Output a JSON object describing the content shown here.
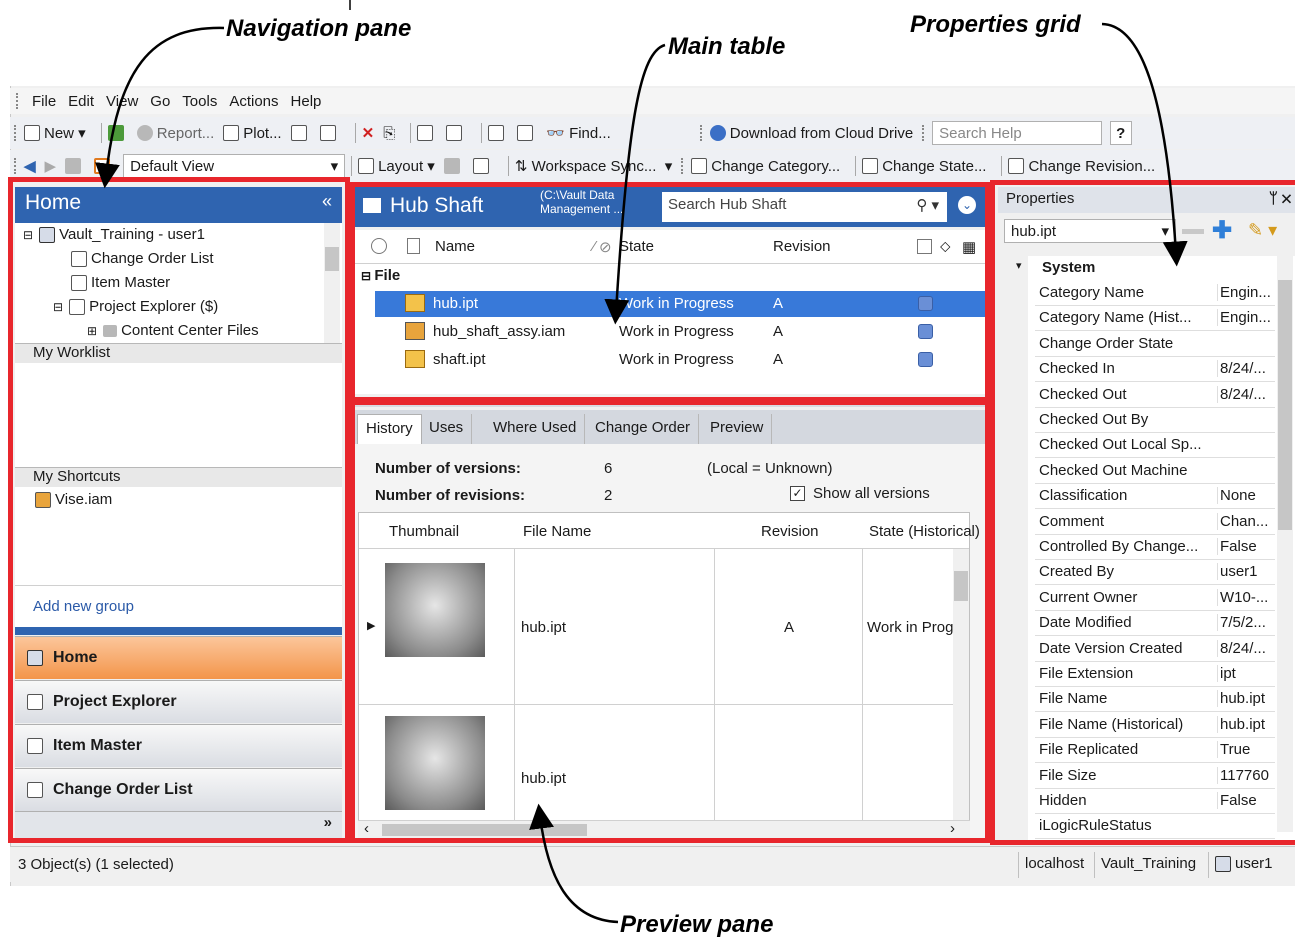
{
  "callouts": {
    "navigation": "Navigation pane",
    "main_table": "Main table",
    "properties": "Properties grid",
    "preview": "Preview pane"
  },
  "menu": [
    "File",
    "Edit",
    "View",
    "Go",
    "Tools",
    "Actions",
    "Help"
  ],
  "toolbar1": {
    "new": "New",
    "report": "Report...",
    "plot": "Plot...",
    "find": "Find...",
    "download": "Download from Cloud Drive",
    "search_help_placeholder": "Search Help",
    "help_button": "?"
  },
  "toolbar2": {
    "view_combo": "Default View",
    "layout": "Layout",
    "workspace_sync": "Workspace Sync...",
    "change_category": "Change Category...",
    "change_state": "Change State...",
    "change_revision": "Change Revision..."
  },
  "nav": {
    "title": "Home",
    "collapse_glyph": "«",
    "tree": [
      {
        "label": "Vault_Training - user1"
      },
      {
        "label": "Change Order List"
      },
      {
        "label": "Item Master"
      },
      {
        "label": "Project Explorer ($)"
      },
      {
        "label": "Content Center Files"
      }
    ],
    "worklist_title": "My Worklist",
    "shortcuts_title": "My Shortcuts",
    "shortcut_item": "Vise.iam",
    "add_group": "Add new group",
    "buttons": [
      "Home",
      "Project Explorer",
      "Item Master",
      "Change Order List"
    ],
    "more_glyph": "»"
  },
  "main": {
    "title": "Hub Shaft",
    "path_line1": "(C:\\Vault Data",
    "path_line2": "Management ...",
    "search_placeholder": "Search Hub Shaft",
    "columns": {
      "name": "Name",
      "state": "State",
      "revision": "Revision"
    },
    "group_label": "File",
    "rows": [
      {
        "name": "hub.ipt",
        "state": "Work in Progress",
        "revision": "A",
        "selected": true
      },
      {
        "name": "hub_shaft_assy.iam",
        "state": "Work in Progress",
        "revision": "A",
        "selected": false
      },
      {
        "name": "shaft.ipt",
        "state": "Work in Progress",
        "revision": "A",
        "selected": false
      }
    ]
  },
  "preview": {
    "tabs": [
      "History",
      "Uses",
      "Where Used",
      "Change Order",
      "Preview"
    ],
    "versions_label": "Number of versions:",
    "versions_value": "6",
    "local_label": "(Local = Unknown)",
    "revisions_label": "Number of revisions:",
    "revisions_value": "2",
    "show_all": "Show all versions",
    "columns": {
      "thumbnail": "Thumbnail",
      "file_name": "File Name",
      "revision": "Revision",
      "state": "State (Historical)"
    },
    "rows": [
      {
        "file_name": "hub.ipt",
        "revision": "A",
        "state": "Work in Progr"
      },
      {
        "file_name": "hub.ipt",
        "revision": "",
        "state": ""
      }
    ]
  },
  "properties": {
    "title": "Properties",
    "pin_glyph": "ᛘ ✕",
    "selected_file": "hub.ipt",
    "group": "System",
    "rows": [
      {
        "key": "Category Name",
        "value": "Engin..."
      },
      {
        "key": "Category Name (Hist...",
        "value": "Engin..."
      },
      {
        "key": "Change Order State",
        "value": ""
      },
      {
        "key": "Checked In",
        "value": "8/24/..."
      },
      {
        "key": "Checked Out",
        "value": "8/24/..."
      },
      {
        "key": "Checked Out By",
        "value": ""
      },
      {
        "key": "Checked Out Local Sp...",
        "value": ""
      },
      {
        "key": "Checked Out Machine",
        "value": ""
      },
      {
        "key": "Classification",
        "value": "None"
      },
      {
        "key": "Comment",
        "value": "Chan..."
      },
      {
        "key": "Controlled By Change...",
        "value": "False"
      },
      {
        "key": "Created By",
        "value": "user1"
      },
      {
        "key": "Current Owner",
        "value": "W10-..."
      },
      {
        "key": "Date Modified",
        "value": "7/5/2..."
      },
      {
        "key": "Date Version Created",
        "value": "8/24/..."
      },
      {
        "key": "File Extension",
        "value": "ipt"
      },
      {
        "key": "File Name",
        "value": "hub.ipt"
      },
      {
        "key": "File Name (Historical)",
        "value": "hub.ipt"
      },
      {
        "key": "File Replicated",
        "value": "True"
      },
      {
        "key": "File Size",
        "value": "117760"
      },
      {
        "key": "Hidden",
        "value": "False"
      },
      {
        "key": "iLogicRuleStatus",
        "value": ""
      }
    ]
  },
  "status": {
    "left": "3 Object(s) (1 selected)",
    "server": "localhost",
    "vault": "Vault_Training",
    "user": "user1"
  },
  "colors": {
    "accent": "#2f64b0",
    "highlight": "#e8262c",
    "active_nav": "#f3954a"
  }
}
